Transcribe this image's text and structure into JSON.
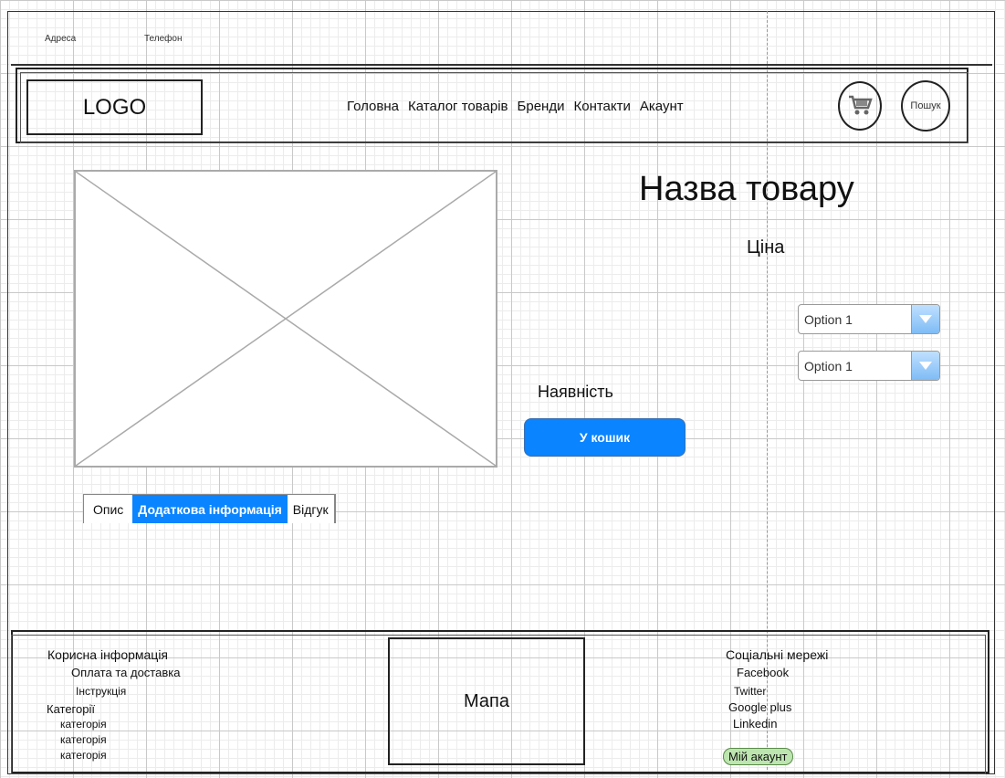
{
  "topbar": {
    "address": "Адреса",
    "phone": "Телефон"
  },
  "header": {
    "logo": "LOGO",
    "nav": [
      "Головна",
      "Каталог товарів",
      "Бренди",
      "Контакти",
      "Акаунт"
    ],
    "search_label": "Пошук"
  },
  "product": {
    "title": "Назва товару",
    "price": "Ціна",
    "options": [
      {
        "value": "Option 1"
      },
      {
        "value": "Option 1"
      }
    ],
    "availability": "Наявність",
    "cart_button": "У кошик",
    "tabs": [
      "Опис",
      "Додаткова інформація",
      "Відгук"
    ],
    "active_tab": 1
  },
  "footer": {
    "useful_info": {
      "heading": "Корисна інформація",
      "links": [
        "Оплата та доставка",
        "Інструкція"
      ]
    },
    "categories": {
      "heading": "Категорії",
      "items": [
        "категорія",
        "категорія",
        "категорія"
      ]
    },
    "map": "Мапа",
    "social": {
      "heading": "Соціальні мережі",
      "items": [
        "Facebook",
        "Twitter",
        "Google plus",
        "Linkedin"
      ]
    },
    "my_account": "Мій акаунт"
  },
  "colors": {
    "accent": "#0a84ff",
    "account_badge": "#bde5b0"
  },
  "icons": [
    "cart-icon",
    "image-placeholder-icon",
    "dropdown-arrow-icon"
  ]
}
